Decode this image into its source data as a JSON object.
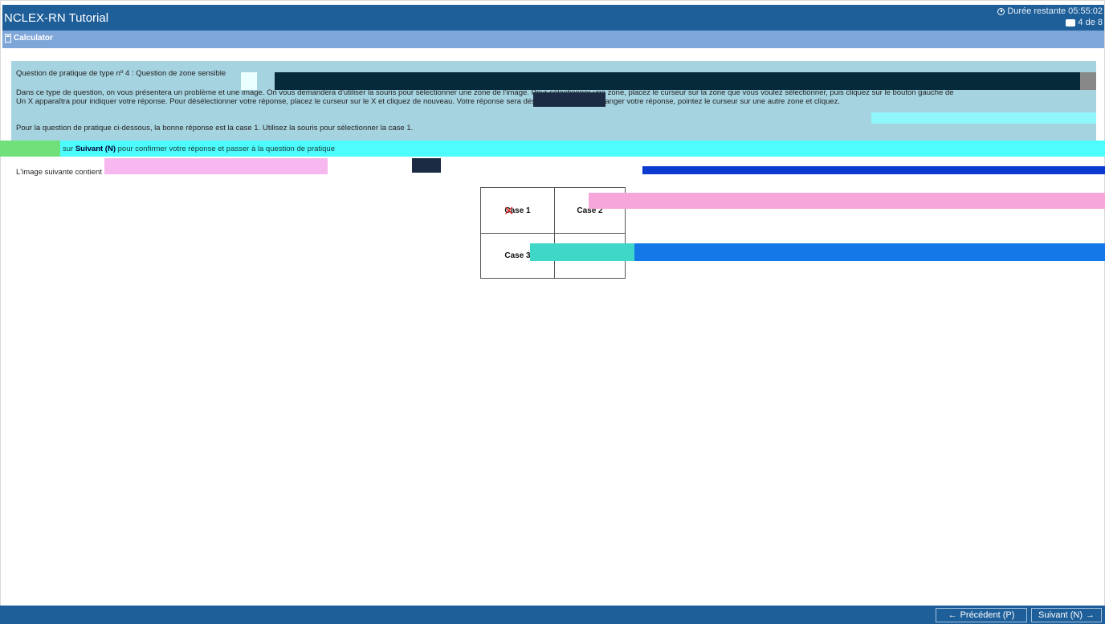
{
  "header": {
    "title": "NCLEX-RN Tutorial",
    "timer_label": "Durée restante 05:55:02",
    "progress_label": "4 de 8"
  },
  "toolbar": {
    "calculator_label": "Calculator"
  },
  "instructions": {
    "p1": "Question de pratique de type nº 4 : Question de zone sensible",
    "p2": "Dans ce type de question, on vous présentera un problème et une image. On vous demandera d'utiliser la souris pour sélectionner une zone de l'image. Pour sélectionner une zone, placez le curseur sur la zone que vous voulez sélectionner, puis cliquez sur le bouton gauche de",
    "p3": "Un X apparaîtra pour indiquer votre réponse. Pour désélectionner votre réponse, placez le curseur sur le X et cliquez de nouveau. Votre réponse sera désélectionnée. Pour changer votre réponse, pointez le curseur sur une autre zone et cliquez.",
    "p4": "Pour la question de pratique ci-dessous, la bonne réponse est la case 1. Utilisez la souris pour sélectionner la case 1."
  },
  "band": {
    "prefix": "sur ",
    "bold": "Suivant (N)",
    "suffix": " pour confirmer votre réponse et passer à la question de pratique"
  },
  "intro": "L'image suivante contient",
  "hotspot": {
    "case1": "Case 1",
    "case2": "Case 2",
    "case3": "Case 3",
    "case4": "",
    "selected": "case1"
  },
  "footer": {
    "prev_label": "Précédent (P)",
    "next_label": "Suivant (N)"
  }
}
